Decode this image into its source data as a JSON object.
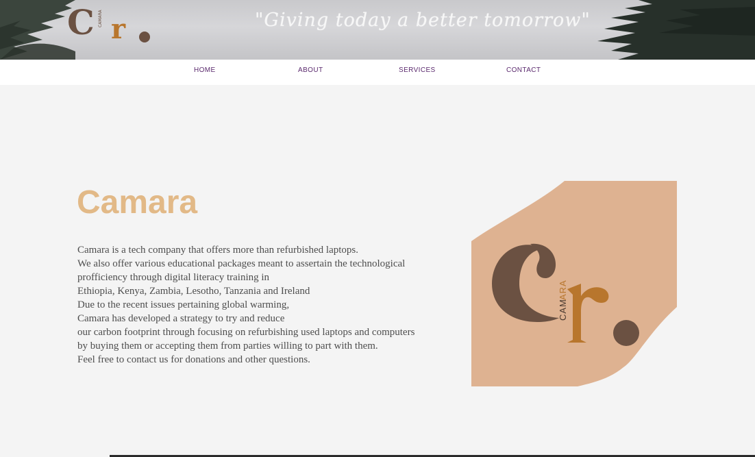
{
  "banner": {
    "tagline": "\"Giving today a better tomorrow\"",
    "logo_letters": "Cr",
    "logo_small_text": "CAMARA"
  },
  "nav": {
    "items": [
      {
        "label": "HOME"
      },
      {
        "label": "ABOUT"
      },
      {
        "label": "SERVICES"
      },
      {
        "label": "CONTACT"
      }
    ]
  },
  "main": {
    "title": "Camara",
    "paragraph_lines": [
      "Camara is a tech company that offers more than refurbished laptops.",
      "We also offer various educational packages meant to assertain the technological",
      "profficiency through digital literacy training in",
      "Ethiopia, Kenya, Zambia, Lesotho, Tanzania and Ireland",
      "Due to the recent issues pertaining global warming,",
      "Camara has developed a strategy to try and reduce",
      "our carbon footprint through focusing on refurbishing used laptops and computers",
      "by buying them or accepting them from parties willing to part with them.",
      "Feel free to contact us for donations and other questions."
    ]
  },
  "hero_logo": {
    "letter_c": "C",
    "letter_r": "r",
    "text_cam": "CAM",
    "text_ara": "ARA"
  },
  "colors": {
    "title": "#e2b987",
    "nav_text": "#5b2a6e",
    "logo_bg": "#deb291",
    "logo_brown": "#6b5142",
    "logo_orange": "#b8762d",
    "page_bg": "#f4f4f4"
  }
}
